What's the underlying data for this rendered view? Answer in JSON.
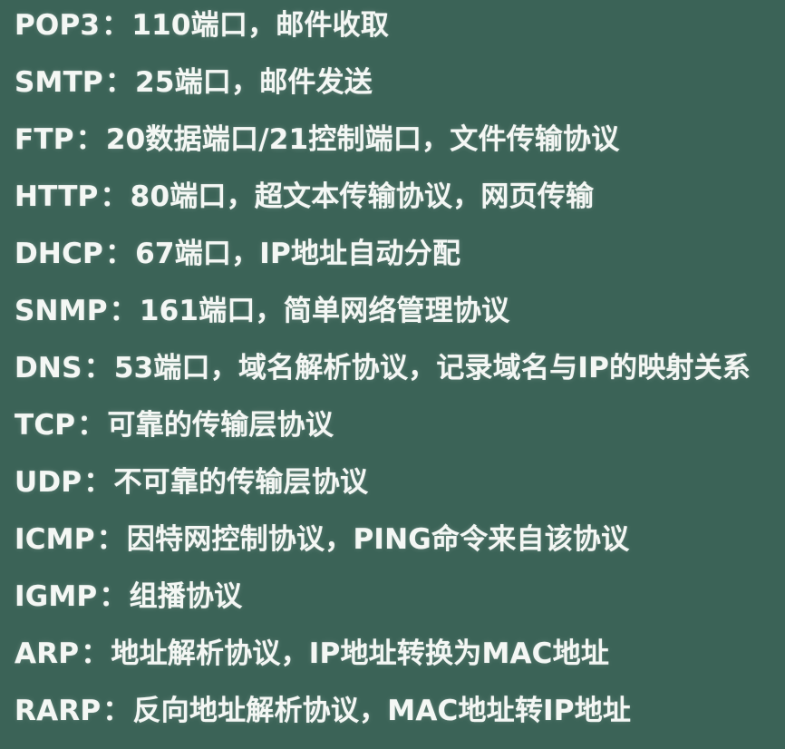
{
  "items": [
    {
      "term": "POP3",
      "desc": "110端口，邮件收取"
    },
    {
      "term": "SMTP",
      "desc": "25端口，邮件发送"
    },
    {
      "term": "FTP",
      "desc": "20数据端口/21控制端口，文件传输协议"
    },
    {
      "term": "HTTP",
      "desc": "80端口，超文本传输协议，网页传输"
    },
    {
      "term": "DHCP",
      "desc": "67端口，IP地址自动分配"
    },
    {
      "term": "SNMP",
      "desc": "161端口，简单网络管理协议"
    },
    {
      "term": "DNS",
      "desc": "53端口，域名解析协议，记录域名与IP的映射关系"
    },
    {
      "term": "TCP",
      "desc": "可靠的传输层协议"
    },
    {
      "term": "UDP",
      "desc": "不可靠的传输层协议"
    },
    {
      "term": "ICMP",
      "desc": "因特网控制协议，PING命令来自该协议"
    },
    {
      "term": "IGMP",
      "desc": "组播协议"
    },
    {
      "term": "ARP",
      "desc": "地址解析协议，IP地址转换为MAC地址"
    },
    {
      "term": "RARP",
      "desc": "反向地址解析协议，MAC地址转IP地址"
    }
  ],
  "separator": "：",
  "colors": {
    "background": "#3b6357",
    "text": "#f4f7f4"
  }
}
